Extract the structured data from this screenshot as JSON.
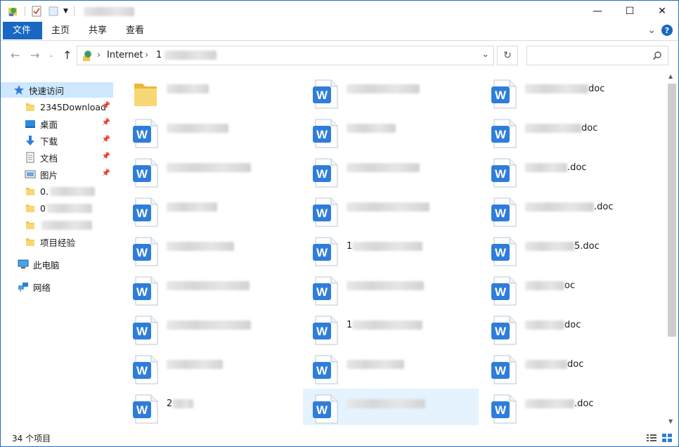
{
  "window": {
    "title": "",
    "minimize": "—",
    "maximize": "☐",
    "close": "✕"
  },
  "ribbon": {
    "tabs": [
      "文件",
      "主页",
      "共享",
      "查看"
    ],
    "collapse": "⌄",
    "help": "?"
  },
  "address": {
    "crumbs": [
      "Internet",
      "1"
    ],
    "search_placeholder": ""
  },
  "nav_pane": {
    "items": [
      {
        "label": "快速访问",
        "icon": "star-icon",
        "selected": true
      },
      {
        "label": "2345Download",
        "icon": "folder-icon",
        "pinned": true
      },
      {
        "label": "桌面",
        "icon": "desktop-icon",
        "pinned": true
      },
      {
        "label": "下载",
        "icon": "download-icon",
        "pinned": true
      },
      {
        "label": "文档",
        "icon": "document-icon",
        "pinned": true
      },
      {
        "label": "图片",
        "icon": "picture-icon",
        "pinned": true
      },
      {
        "label": "0.",
        "icon": "folder-icon"
      },
      {
        "label": "0",
        "icon": "folder-icon"
      },
      {
        "label": "",
        "icon": "folder-icon"
      },
      {
        "label": "项目经验",
        "icon": "folder-icon"
      },
      {
        "label": "此电脑",
        "icon": "computer-icon"
      },
      {
        "label": "网络",
        "icon": "network-icon"
      }
    ]
  },
  "files": [
    {
      "prefix": "",
      "suffix": "",
      "type": "folder"
    },
    {
      "prefix": "",
      "suffix": "",
      "type": "wps"
    },
    {
      "prefix": "",
      "suffix": "doc",
      "type": "wps"
    },
    {
      "prefix": "",
      "suffix": "",
      "type": "wps"
    },
    {
      "prefix": "",
      "suffix": "",
      "type": "wps"
    },
    {
      "prefix": "",
      "suffix": "doc",
      "type": "wps"
    },
    {
      "prefix": "",
      "suffix": "",
      "type": "wps"
    },
    {
      "prefix": "",
      "suffix": "",
      "type": "wps"
    },
    {
      "prefix": "",
      "suffix": ".doc",
      "type": "wps"
    },
    {
      "prefix": "",
      "suffix": "",
      "type": "wps"
    },
    {
      "prefix": "",
      "suffix": "",
      "type": "wps"
    },
    {
      "prefix": "",
      "suffix": ".doc",
      "type": "wps"
    },
    {
      "prefix": "",
      "suffix": "",
      "type": "wps"
    },
    {
      "prefix": "1",
      "suffix": "",
      "type": "wps"
    },
    {
      "prefix": "",
      "suffix": "5.doc",
      "type": "wps"
    },
    {
      "prefix": "",
      "suffix": "",
      "type": "wps"
    },
    {
      "prefix": "",
      "suffix": "",
      "type": "wps"
    },
    {
      "prefix": "",
      "suffix": "oc",
      "type": "wps"
    },
    {
      "prefix": "",
      "suffix": "",
      "type": "wps"
    },
    {
      "prefix": "1",
      "suffix": "",
      "type": "wps"
    },
    {
      "prefix": "",
      "suffix": "doc",
      "type": "wps"
    },
    {
      "prefix": "",
      "suffix": "",
      "type": "wps"
    },
    {
      "prefix": "",
      "suffix": "",
      "type": "wps"
    },
    {
      "prefix": "",
      "suffix": "doc",
      "type": "wps"
    },
    {
      "prefix": "2",
      "suffix": "",
      "type": "wps"
    },
    {
      "prefix": "",
      "suffix": "",
      "type": "wps",
      "selected": true
    },
    {
      "prefix": "",
      "suffix": ".doc",
      "type": "wps"
    }
  ],
  "status": {
    "count": "34 个项目"
  },
  "colors": {
    "accent": "#1967c2",
    "selection": "#cde8ff",
    "file_selection": "#e5f3ff",
    "wps_blue": "#2f7ddb"
  }
}
